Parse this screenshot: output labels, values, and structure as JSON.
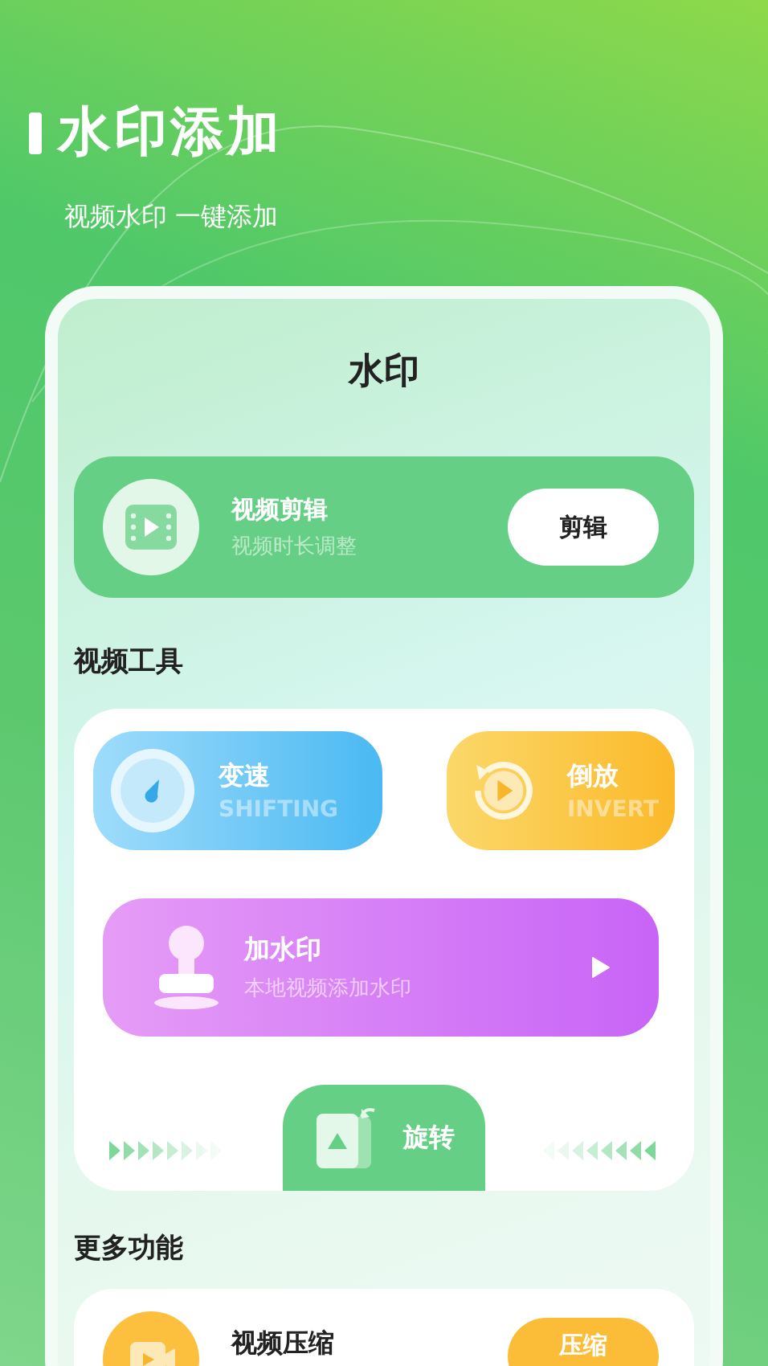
{
  "header": {
    "title": "水印添加",
    "subtitle": "视频水印 一键添加"
  },
  "panel": {
    "title": "水印"
  },
  "banner": {
    "title": "视频剪辑",
    "subtitle": "视频时长调整",
    "button": "剪辑"
  },
  "tools": {
    "heading": "视频工具",
    "items": [
      {
        "kind": "speed",
        "title": "变速",
        "subtitle": "SHIFTING"
      },
      {
        "kind": "reverse",
        "title": "倒放",
        "subtitle": "INVERT"
      },
      {
        "kind": "watermark",
        "title": "加水印",
        "subtitle": "本地视频添加水印"
      },
      {
        "kind": "rotate",
        "title": "旋转"
      }
    ]
  },
  "more": {
    "heading": "更多功能",
    "items": [
      {
        "title": "视频压缩",
        "button": "压缩"
      }
    ]
  }
}
